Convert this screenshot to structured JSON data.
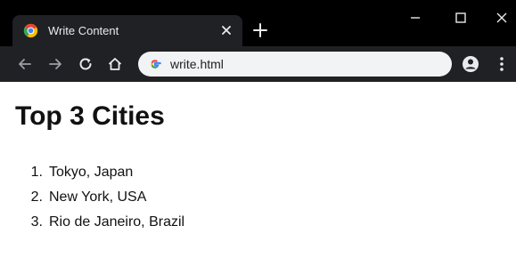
{
  "browser": {
    "tab": {
      "title": "Write Content",
      "favicon": "chrome-logo-icon"
    },
    "window_controls": [
      "minimize-icon",
      "maximize-icon",
      "close-icon"
    ],
    "toolbar": {
      "icons": [
        "back-arrow-icon",
        "forward-arrow-icon",
        "reload-icon",
        "home-icon",
        "account-icon",
        "menu-dots-icon"
      ],
      "address": "write.html"
    },
    "colors": {
      "tabstrip": "#000000",
      "toolbar": "#202124",
      "omnibox": "#f1f3f4"
    }
  },
  "page": {
    "heading": "Top 3 Cities",
    "cities": [
      {
        "num": "1.",
        "name": "Tokyo, Japan"
      },
      {
        "num": "2.",
        "name": "New York, USA"
      },
      {
        "num": "3.",
        "name": "Rio de Janeiro, Brazil"
      }
    ]
  }
}
